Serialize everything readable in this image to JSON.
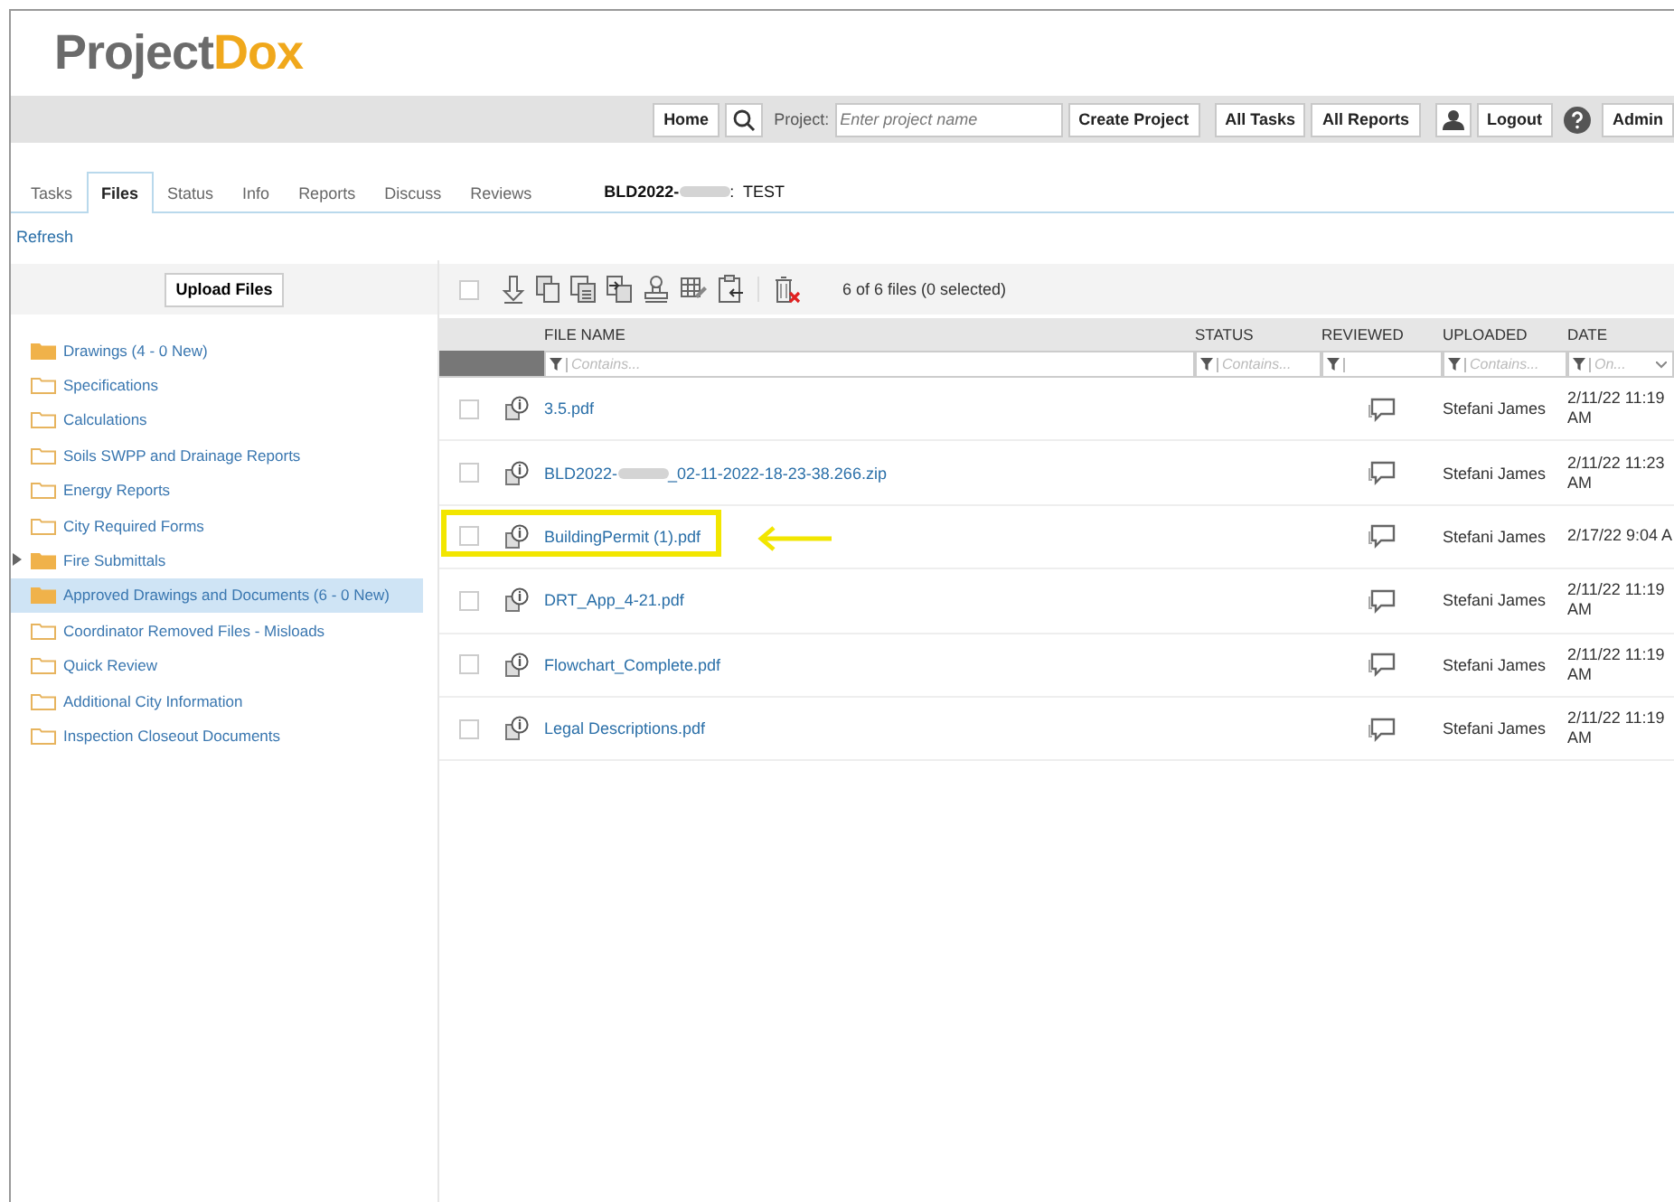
{
  "logo": {
    "part_1": "Project",
    "part_2": "Dox"
  },
  "top_bar": {
    "home": "Home",
    "project_label": "Project:",
    "project_placeholder": "Enter project name",
    "create": "Create Project",
    "all_tasks": "All Tasks",
    "all_reports": "All Reports",
    "logout": "Logout",
    "admin": "Admin"
  },
  "tabs": [
    {
      "label": "Tasks",
      "selected": false
    },
    {
      "label": "Files",
      "selected": true
    },
    {
      "label": "Status",
      "selected": false
    },
    {
      "label": "Info",
      "selected": false
    },
    {
      "label": "Reports",
      "selected": false
    },
    {
      "label": "Discuss",
      "selected": false
    },
    {
      "label": "Reviews",
      "selected": false
    }
  ],
  "project_title": {
    "prefix": "BLD2022-",
    "suffix": ":  TEST"
  },
  "refresh": "Refresh",
  "upload_button": "Upload Files",
  "folders": [
    {
      "name": "Drawings (4 - 0 New)",
      "has_files": true,
      "expandable": false,
      "selected": false
    },
    {
      "name": "Specifications",
      "has_files": false,
      "expandable": false,
      "selected": false
    },
    {
      "name": "Calculations",
      "has_files": false,
      "expandable": false,
      "selected": false
    },
    {
      "name": "Soils SWPP and Drainage Reports",
      "has_files": false,
      "expandable": false,
      "selected": false
    },
    {
      "name": "Energy Reports",
      "has_files": false,
      "expandable": false,
      "selected": false
    },
    {
      "name": "City Required Forms",
      "has_files": false,
      "expandable": false,
      "selected": false
    },
    {
      "name": "Fire Submittals",
      "has_files": true,
      "expandable": true,
      "selected": false
    },
    {
      "name": "Approved Drawings and Documents (6 - 0 New)",
      "has_files": true,
      "expandable": false,
      "selected": true
    },
    {
      "name": "Coordinator Removed Files - Misloads",
      "has_files": false,
      "expandable": false,
      "selected": false
    },
    {
      "name": "Quick Review",
      "has_files": false,
      "expandable": false,
      "selected": false
    },
    {
      "name": "Additional City Information",
      "has_files": false,
      "expandable": false,
      "selected": false
    },
    {
      "name": "Inspection Closeout Documents",
      "has_files": false,
      "expandable": false,
      "selected": false
    }
  ],
  "select_all": {
    "checked": false
  },
  "file_count": "6 of 6 files (0 selected)",
  "table": {
    "columns": [
      {
        "label": "FILE NAME",
        "filter": "Contains..."
      },
      {
        "label": "STATUS",
        "filter": "Contains..."
      },
      {
        "label": "REVIEWED"
      },
      {
        "label": "UPLOADED",
        "filter": "Contains..."
      },
      {
        "label": "DATE",
        "filter": "On..."
      }
    ],
    "rows": [
      {
        "name": "3.5.pdf",
        "checked": false,
        "highlighted": false,
        "uploaded": "Stefani James",
        "date": "2/11/22 11:19 AM"
      },
      {
        "name": "BLD2022-",
        "name_suffix": "_02-11-2022-18-23-38.266.zip",
        "checked": false,
        "highlighted": false,
        "uploaded": "Stefani James",
        "date": "2/11/22 11:23 AM"
      },
      {
        "name": "BuildingPermit (1).pdf",
        "checked": false,
        "highlighted": true,
        "uploaded": "Stefani James",
        "date": "2/17/22 9:04 A"
      },
      {
        "name": "DRT_App_4-21.pdf",
        "checked": false,
        "highlighted": false,
        "uploaded": "Stefani James",
        "date": "2/11/22 11:19 AM"
      },
      {
        "name": "Flowchart_Complete.pdf",
        "checked": false,
        "highlighted": false,
        "uploaded": "Stefani James",
        "date": "2/11/22 11:19 AM"
      },
      {
        "name": "Legal Descriptions.pdf",
        "checked": false,
        "highlighted": false,
        "uploaded": "Stefani James",
        "date": "2/11/22 11:19 AM"
      }
    ]
  }
}
